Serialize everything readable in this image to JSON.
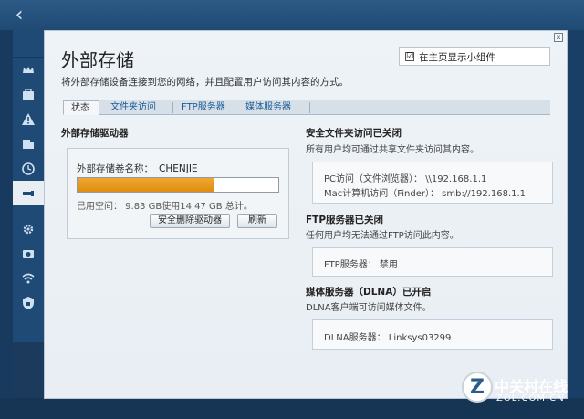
{
  "dialog": {
    "title": "外部存储",
    "subtitle": "将外部存储设备连接到您的网络，并且配置用户访问其内容的方式。",
    "close_label": "x",
    "widget_checkbox": {
      "checked_mark": "☑",
      "label": "在主页显示小组件"
    }
  },
  "tabs": [
    {
      "label": "状态",
      "active": true
    },
    {
      "label": "文件夹访问",
      "active": false
    },
    {
      "label": "FTP服务器",
      "active": false
    },
    {
      "label": "媒体服务器",
      "active": false
    }
  ],
  "drive": {
    "section_title": "外部存储驱动器",
    "name_label": "外部存储卷名称：",
    "name_value": "CHENJIE",
    "used_fraction": 0.68,
    "usage_text": "已用空间： 9.83 GB使用14.47 GB 总计。",
    "safe_remove_button": "安全删除驱动器",
    "refresh_button": "刷新"
  },
  "secure_access": {
    "title": "安全文件夹访问已关闭",
    "desc": "所有用户均可通过共享文件夹访问其内容。",
    "pc_line": "PC访问（文件浏览器）：  \\\\192.168.1.1",
    "mac_line": "Mac计算机访问（Finder）：  smb://192.168.1.1"
  },
  "ftp": {
    "title": "FTP服务器已关闭",
    "desc": "任何用户均无法通过FTP访问此内容。",
    "line": "FTP服务器：  禁用"
  },
  "dlna": {
    "title": "媒体服务器（DLNA）已开启",
    "desc": "DLNA客户端可访问媒体文件。",
    "line": "DLNA服务器：  Linksys03299"
  },
  "nav": {
    "back_glyph": "‹"
  },
  "watermark": {
    "logo_letter": "Z",
    "cn": "中关村在线",
    "en": "ZOL.COM.CN"
  },
  "colors": {
    "accent": "#1a5c94",
    "progress": "#e8981e",
    "sidebar": "#1e4a75"
  },
  "icons": [
    "crown-icon",
    "toolbox-icon",
    "warning-icon",
    "devices-icon",
    "clock-icon",
    "usb-icon",
    "gear-icon",
    "camera-icon",
    "wifi-icon",
    "shield-icon"
  ]
}
